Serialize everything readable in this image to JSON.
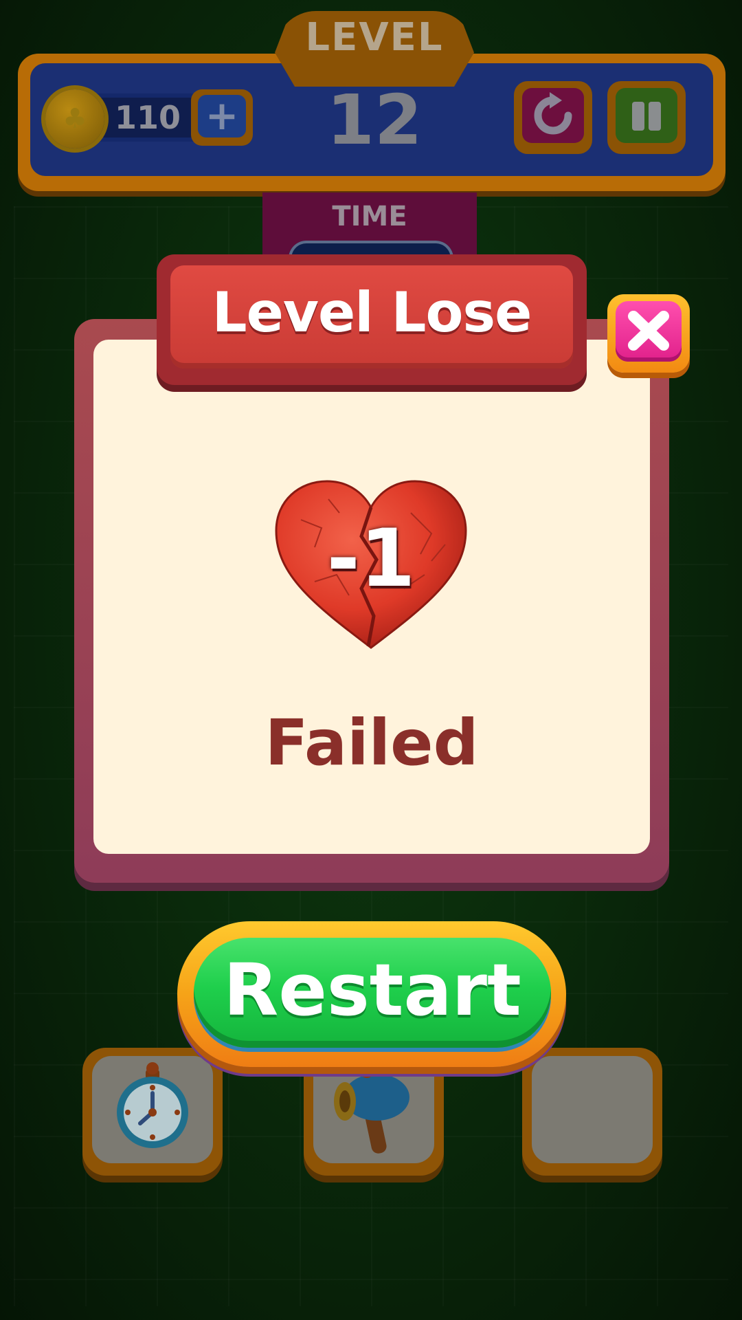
{
  "hud": {
    "level_label": "LEVEL",
    "level_number": "12",
    "coins": "110",
    "add_coins_label": "+",
    "time_label": "TIME"
  },
  "modal": {
    "title": "Level Lose",
    "lives_change": "-1",
    "status": "Failed"
  },
  "actions": {
    "restart_label": "Restart"
  },
  "powerups": [
    {
      "icon": "stopwatch-icon"
    },
    {
      "icon": "hammer-icon"
    },
    {
      "icon": "empty-slot"
    }
  ],
  "colors": {
    "title_red": "#d9423c",
    "close_pink": "#e0208a",
    "restart_green": "#1fcf4c",
    "failed_text": "#8a2f2a",
    "modal_background": "#fff3dc"
  }
}
